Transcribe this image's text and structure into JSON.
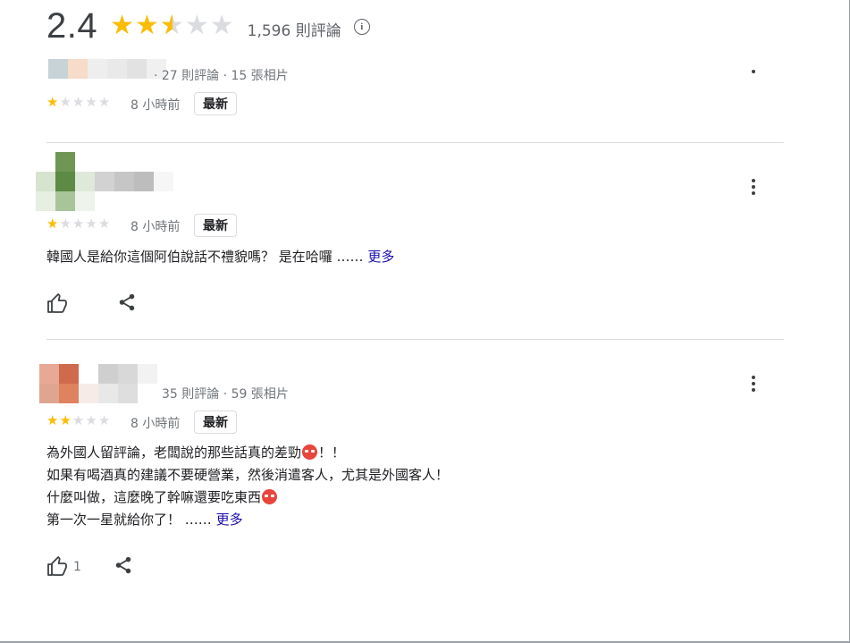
{
  "summary": {
    "rating": "2.4",
    "stars": 2.4,
    "review_count": "1,596 則評論",
    "info_icon": "info-icon"
  },
  "reviews": [
    {
      "meta": "· 27 則評論 · 15 張相片",
      "stars": 1,
      "time": "8 小時前",
      "badge": "最新"
    },
    {
      "meta": "",
      "stars": 1,
      "time": "8 小時前",
      "badge": "最新",
      "lines": [
        "韓國人是給你這個阿伯說話不禮貌嗎？ 是在哈囉 ……"
      ],
      "more": "更多",
      "like_count": ""
    },
    {
      "meta": "35 則評論 · 59 張相片",
      "stars": 2,
      "time": "8 小時前",
      "badge": "最新",
      "lines": [
        "為外國人留評論，老闆說的那些話真的差勁",
        "！！",
        "如果有喝酒真的建議不要硬營業，然後消遣客人，尤其是外國客人！",
        "什麼叫做，這麼晚了幹嘛還要吃東西",
        "第一次一星就給你了！ ……"
      ],
      "more": "更多",
      "like_count": "1"
    }
  ],
  "icons": {
    "thumb": "thumb-up-icon",
    "share": "share-icon",
    "more": "more-vert-icon",
    "emoji": "angry-face-icon"
  },
  "colors": {
    "star": "#fbbc04",
    "star_empty": "#dadce0",
    "link": "#1a0dab",
    "meta": "#70757a"
  }
}
